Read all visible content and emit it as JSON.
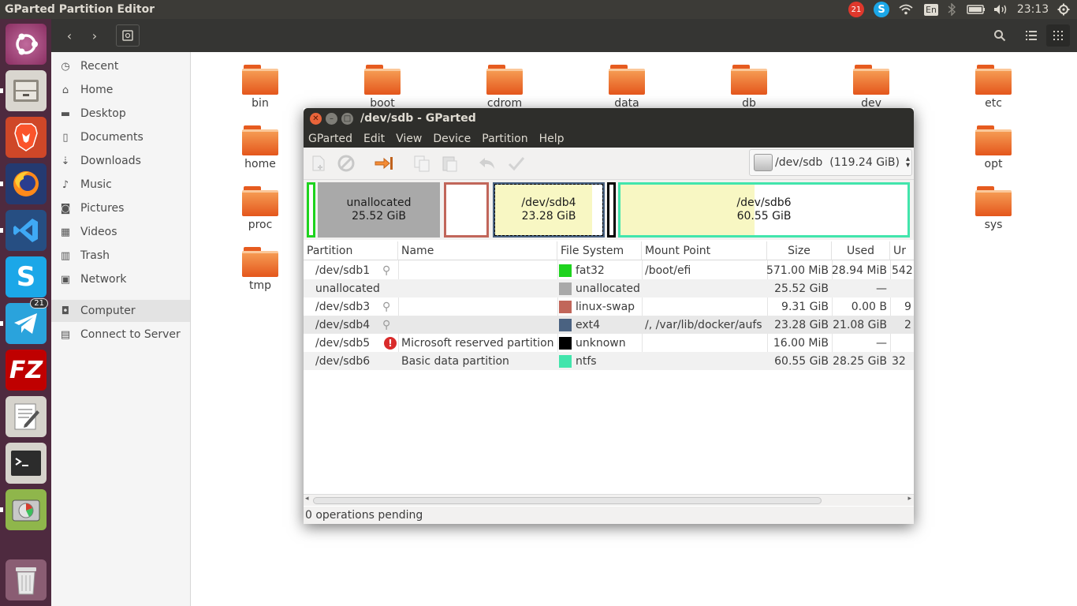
{
  "topbar": {
    "title": "GParted Partition Editor",
    "notif_count": "21",
    "skype": "S",
    "keyboard": "En",
    "clock": "23:13"
  },
  "launcher": {
    "telegram_count": "21",
    "filezilla": "FZ",
    "skype": "S"
  },
  "sidebar": {
    "items": [
      "Recent",
      "Home",
      "Desktop",
      "Documents",
      "Downloads",
      "Music",
      "Pictures",
      "Videos",
      "Trash",
      "Network",
      "Computer",
      "Connect to Server"
    ]
  },
  "folders": [
    "bin",
    "boot",
    "cdrom",
    "data",
    "db",
    "dev",
    "etc",
    "home",
    "opt",
    "proc",
    "sys",
    "tmp"
  ],
  "gparted": {
    "title": "/dev/sdb - GParted",
    "menu": [
      "GParted",
      "Edit",
      "View",
      "Device",
      "Partition",
      "Help"
    ],
    "device": "/dev/sdb",
    "device_size": "(119.24 GiB)",
    "map": {
      "unalloc_name": "unallocated",
      "unalloc_size": "25.52 GiB",
      "sdb4_name": "/dev/sdb4",
      "sdb4_size": "23.28 GiB",
      "sdb6_name": "/dev/sdb6",
      "sdb6_size": "60.55 GiB",
      "sdb4_used_fraction": 0.905,
      "sdb6_used_fraction": 0.467
    },
    "columns": [
      "Partition",
      "Name",
      "File System",
      "Mount Point",
      "Size",
      "Used",
      "Ur"
    ],
    "rows": [
      {
        "partition": "/dev/sdb1",
        "name": "",
        "fs": "fat32",
        "fs_color": "#1ed31e",
        "mount": "/boot/efi",
        "size": "571.00 MiB",
        "used": "28.94 MiB",
        "unused": "542"
      },
      {
        "partition": "unallocated",
        "name": "",
        "fs": "unallocated",
        "fs_color": "#a9a9a9",
        "mount": "",
        "size": "25.52 GiB",
        "used": "—",
        "unused": ""
      },
      {
        "partition": "/dev/sdb3",
        "name": "",
        "fs": "linux-swap",
        "fs_color": "#c1665a",
        "mount": "",
        "size": "9.31 GiB",
        "used": "0.00 B",
        "unused": "9"
      },
      {
        "partition": "/dev/sdb4",
        "name": "",
        "fs": "ext4",
        "fs_color": "#4a6281",
        "mount": "/, /var/lib/docker/aufs",
        "size": "23.28 GiB",
        "used": "21.08 GiB",
        "unused": "2"
      },
      {
        "partition": "/dev/sdb5",
        "name": "Microsoft reserved partition",
        "fs": "unknown",
        "fs_color": "#000000",
        "mount": "",
        "size": "16.00 MiB",
        "used": "—",
        "unused": ""
      },
      {
        "partition": "/dev/sdb6",
        "name": "Basic data partition",
        "fs": "ntfs",
        "fs_color": "#42e5ac",
        "mount": "",
        "size": "60.55 GiB",
        "used": "28.25 GiB",
        "unused": "32"
      }
    ],
    "status": "0 operations pending"
  }
}
